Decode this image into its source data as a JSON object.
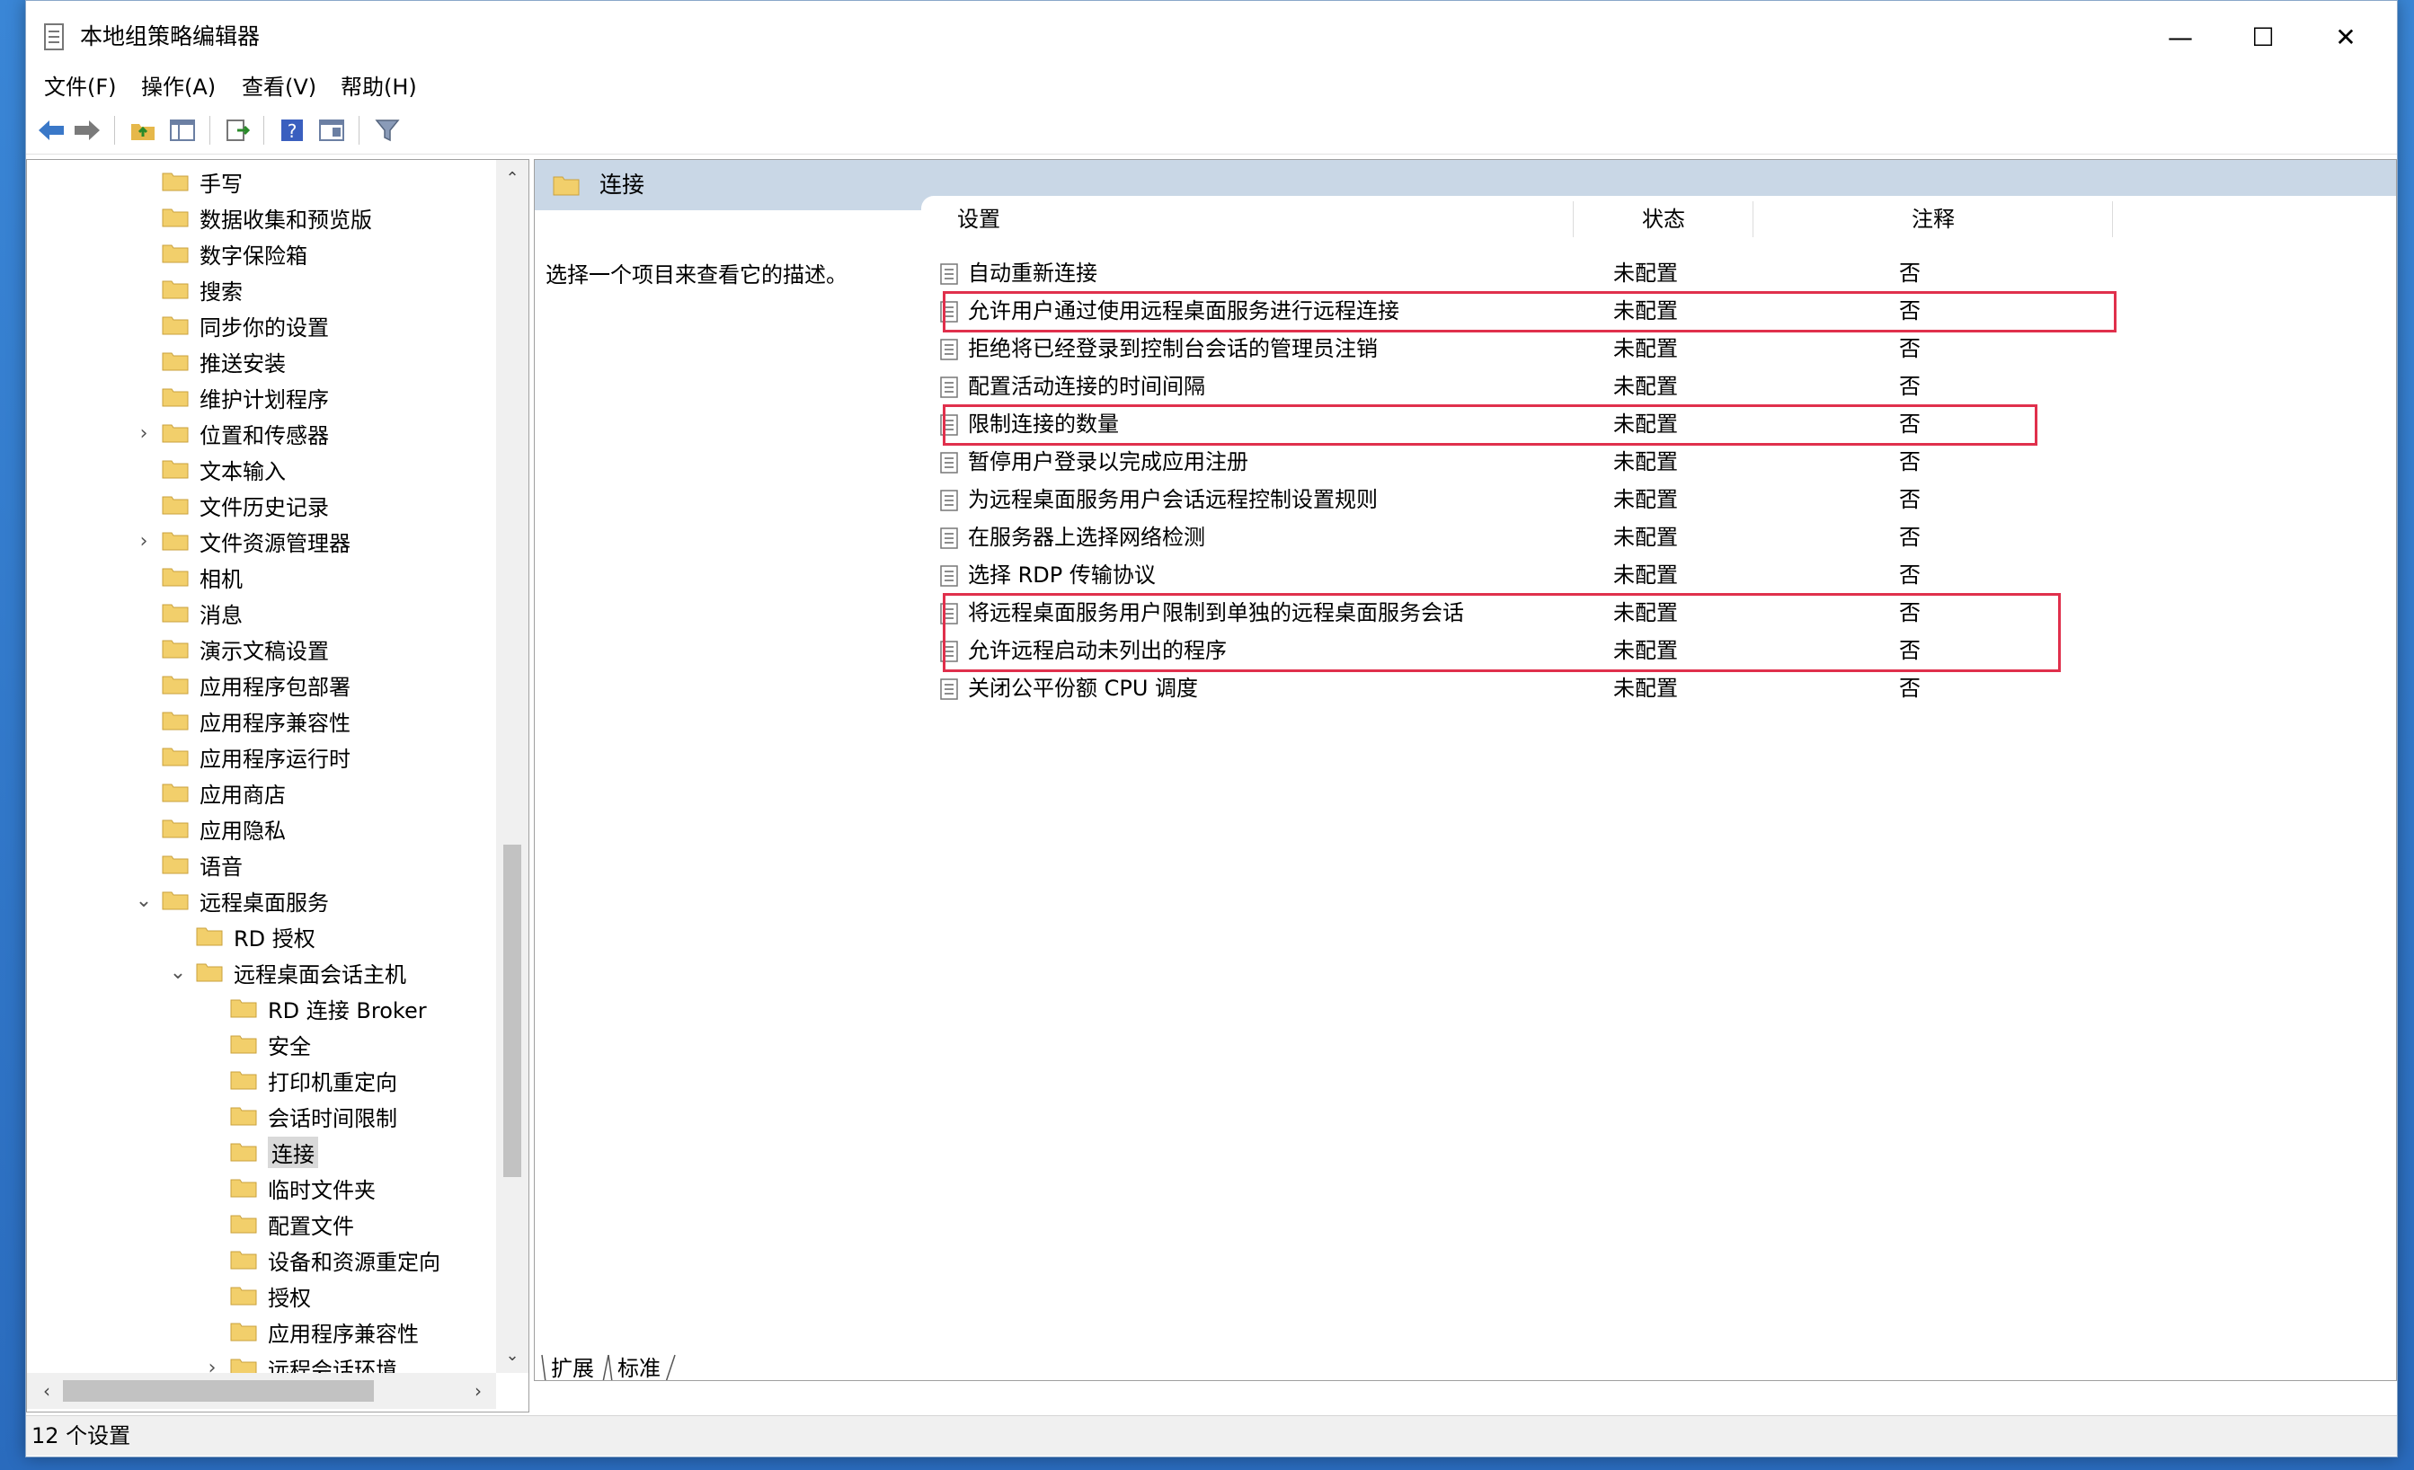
{
  "window": {
    "title": "本地组策略编辑器",
    "controls": {
      "minimize": "—",
      "maximize": "☐",
      "close": "✕"
    }
  },
  "menu": [
    "文件(F)",
    "操作(A)",
    "查看(V)",
    "帮助(H)"
  ],
  "toolbar": [
    "back-icon",
    "forward-icon",
    "up-folder-icon",
    "show-hide-tree-icon",
    "export-list-icon",
    "help-icon",
    "properties-icon",
    "filter-icon"
  ],
  "tree": [
    {
      "label": "手写",
      "indent": 0,
      "expander": ""
    },
    {
      "label": "数据收集和预览版",
      "indent": 0,
      "expander": ""
    },
    {
      "label": "数字保险箱",
      "indent": 0,
      "expander": ""
    },
    {
      "label": "搜索",
      "indent": 0,
      "expander": ""
    },
    {
      "label": "同步你的设置",
      "indent": 0,
      "expander": ""
    },
    {
      "label": "推送安装",
      "indent": 0,
      "expander": ""
    },
    {
      "label": "维护计划程序",
      "indent": 0,
      "expander": ""
    },
    {
      "label": "位置和传感器",
      "indent": 0,
      "expander": "›"
    },
    {
      "label": "文本输入",
      "indent": 0,
      "expander": ""
    },
    {
      "label": "文件历史记录",
      "indent": 0,
      "expander": ""
    },
    {
      "label": "文件资源管理器",
      "indent": 0,
      "expander": "›"
    },
    {
      "label": "相机",
      "indent": 0,
      "expander": ""
    },
    {
      "label": "消息",
      "indent": 0,
      "expander": ""
    },
    {
      "label": "演示文稿设置",
      "indent": 0,
      "expander": ""
    },
    {
      "label": "应用程序包部署",
      "indent": 0,
      "expander": ""
    },
    {
      "label": "应用程序兼容性",
      "indent": 0,
      "expander": ""
    },
    {
      "label": "应用程序运行时",
      "indent": 0,
      "expander": ""
    },
    {
      "label": "应用商店",
      "indent": 0,
      "expander": ""
    },
    {
      "label": "应用隐私",
      "indent": 0,
      "expander": ""
    },
    {
      "label": "语音",
      "indent": 0,
      "expander": ""
    },
    {
      "label": "远程桌面服务",
      "indent": 0,
      "expander": "⌄"
    },
    {
      "label": "RD 授权",
      "indent": 1,
      "expander": ""
    },
    {
      "label": "远程桌面会话主机",
      "indent": 1,
      "expander": "⌄"
    },
    {
      "label": "RD 连接 Broker",
      "indent": 2,
      "expander": ""
    },
    {
      "label": "安全",
      "indent": 2,
      "expander": ""
    },
    {
      "label": "打印机重定向",
      "indent": 2,
      "expander": ""
    },
    {
      "label": "会话时间限制",
      "indent": 2,
      "expander": ""
    },
    {
      "label": "连接",
      "indent": 2,
      "expander": "",
      "selected": true
    },
    {
      "label": "临时文件夹",
      "indent": 2,
      "expander": ""
    },
    {
      "label": "配置文件",
      "indent": 2,
      "expander": ""
    },
    {
      "label": "设备和资源重定向",
      "indent": 2,
      "expander": ""
    },
    {
      "label": "授权",
      "indent": 2,
      "expander": ""
    },
    {
      "label": "应用程序兼容性",
      "indent": 2,
      "expander": ""
    },
    {
      "label": "远程会话环境",
      "indent": 2,
      "expander": "›"
    }
  ],
  "right": {
    "header": "连接",
    "description": "选择一个项目来查看它的描述。",
    "columns": {
      "setting": "设置",
      "state": "状态",
      "note": "注释"
    },
    "rows": [
      {
        "name": "自动重新连接",
        "state": "未配置",
        "note": "否"
      },
      {
        "name": "允许用户通过使用远程桌面服务进行远程连接",
        "state": "未配置",
        "note": "否"
      },
      {
        "name": "拒绝将已经登录到控制台会话的管理员注销",
        "state": "未配置",
        "note": "否"
      },
      {
        "name": "配置活动连接的时间间隔",
        "state": "未配置",
        "note": "否"
      },
      {
        "name": "限制连接的数量",
        "state": "未配置",
        "note": "否"
      },
      {
        "name": "暂停用户登录以完成应用注册",
        "state": "未配置",
        "note": "否"
      },
      {
        "name": "为远程桌面服务用户会话远程控制设置规则",
        "state": "未配置",
        "note": "否"
      },
      {
        "name": "在服务器上选择网络检测",
        "state": "未配置",
        "note": "否"
      },
      {
        "name": "选择 RDP 传输协议",
        "state": "未配置",
        "note": "否"
      },
      {
        "name": "将远程桌面服务用户限制到单独的远程桌面服务会话",
        "state": "未配置",
        "note": "否"
      },
      {
        "name": "允许远程启动未列出的程序",
        "state": "未配置",
        "note": "否"
      },
      {
        "name": "关闭公平份额 CPU 调度",
        "state": "未配置",
        "note": "否"
      }
    ],
    "tabs": [
      "扩展",
      "标准"
    ]
  },
  "status": "12 个设置",
  "colors": {
    "highlight": "#e0304c",
    "header_bg": "#c9d7e6",
    "folder": "#f2cf6b"
  }
}
